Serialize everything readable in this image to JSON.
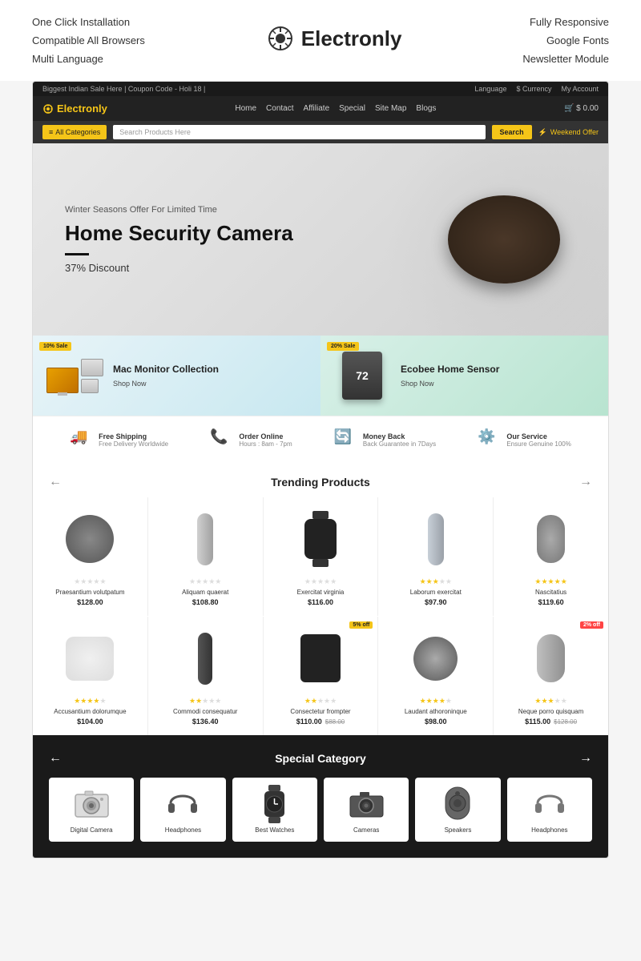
{
  "top": {
    "features_left": [
      "One Click Installation",
      "Compatible All Browsers",
      "Multi Language"
    ],
    "features_right": [
      "Fully Responsive",
      "Google Fonts",
      "Newsletter Module"
    ],
    "logo": "Electronly"
  },
  "store": {
    "topbar": {
      "left": "Biggest Indian Sale Here | Coupon Code - Holi 18 |",
      "language": "Language",
      "currency": "$ Currency",
      "account": "My Account"
    },
    "nav": {
      "logo": "Electronly",
      "links": [
        "Home",
        "Contact",
        "Affiliate",
        "Special",
        "Site Map",
        "Blogs"
      ],
      "cart": "$ 0.00"
    },
    "search": {
      "categories_label": "All Categories",
      "placeholder": "Search Products Here",
      "button": "Search",
      "weekend_offer": "Weekend Offer"
    },
    "hero": {
      "subtitle": "Winter Seasons Offer For Limited Time",
      "title": "Home Security Camera",
      "discount": "37% Discount"
    },
    "promo_cards": [
      {
        "badge": "10% Sale",
        "title": "Mac Monitor Collection",
        "link": "Shop Now"
      },
      {
        "badge": "20% Sale",
        "title": "Ecobee Home Sensor",
        "link": "Shop Now"
      }
    ],
    "features": [
      {
        "icon": "truck",
        "title": "Free Shipping",
        "sub": "Free Delivery Worldwide"
      },
      {
        "icon": "phone",
        "title": "Order Online",
        "sub": "Hours : 8am - 7pm"
      },
      {
        "icon": "refresh",
        "title": "Money Back",
        "sub": "Back Guarantee in 7Days"
      },
      {
        "icon": "gear",
        "title": "Our Service",
        "sub": "Ensure Genuine 100%"
      }
    ],
    "trending": {
      "title": "Trending Products",
      "products_row1": [
        {
          "name": "Praesantium volutpatum",
          "price": "$128.00",
          "stars": 0,
          "old_price": ""
        },
        {
          "name": "Aliquam quaerat",
          "price": "$108.80",
          "stars": 0,
          "old_price": ""
        },
        {
          "name": "Exercitat virginia",
          "price": "$116.00",
          "stars": 0,
          "old_price": ""
        },
        {
          "name": "Laborum exercitat",
          "price": "$97.90",
          "stars": 3,
          "old_price": ""
        },
        {
          "name": "Nascitatius",
          "price": "$119.60",
          "stars": 5,
          "old_price": ""
        }
      ],
      "products_row2": [
        {
          "name": "Accusantium dolorumque",
          "price": "$104.00",
          "stars": 4,
          "badge": "",
          "old_price": ""
        },
        {
          "name": "Commodi consequatur",
          "price": "$136.40",
          "stars": 2,
          "badge": "",
          "old_price": ""
        },
        {
          "name": "Consectetur frompter",
          "price": "$110.00",
          "stars": 2,
          "badge": "5% off",
          "old_price": "$88.00"
        },
        {
          "name": "Laudant athoroninque",
          "price": "$98.00",
          "stars": 4,
          "badge": "",
          "old_price": ""
        },
        {
          "name": "Neque porro quisquam",
          "price": "$115.00",
          "stars": 3,
          "badge": "2% off",
          "old_price": "$128.00"
        }
      ]
    },
    "special": {
      "title": "Special Category",
      "categories": [
        "Digital Camera",
        "Headphones",
        "Best Watches",
        "Cameras",
        "Speakers",
        "Headphones"
      ]
    }
  }
}
